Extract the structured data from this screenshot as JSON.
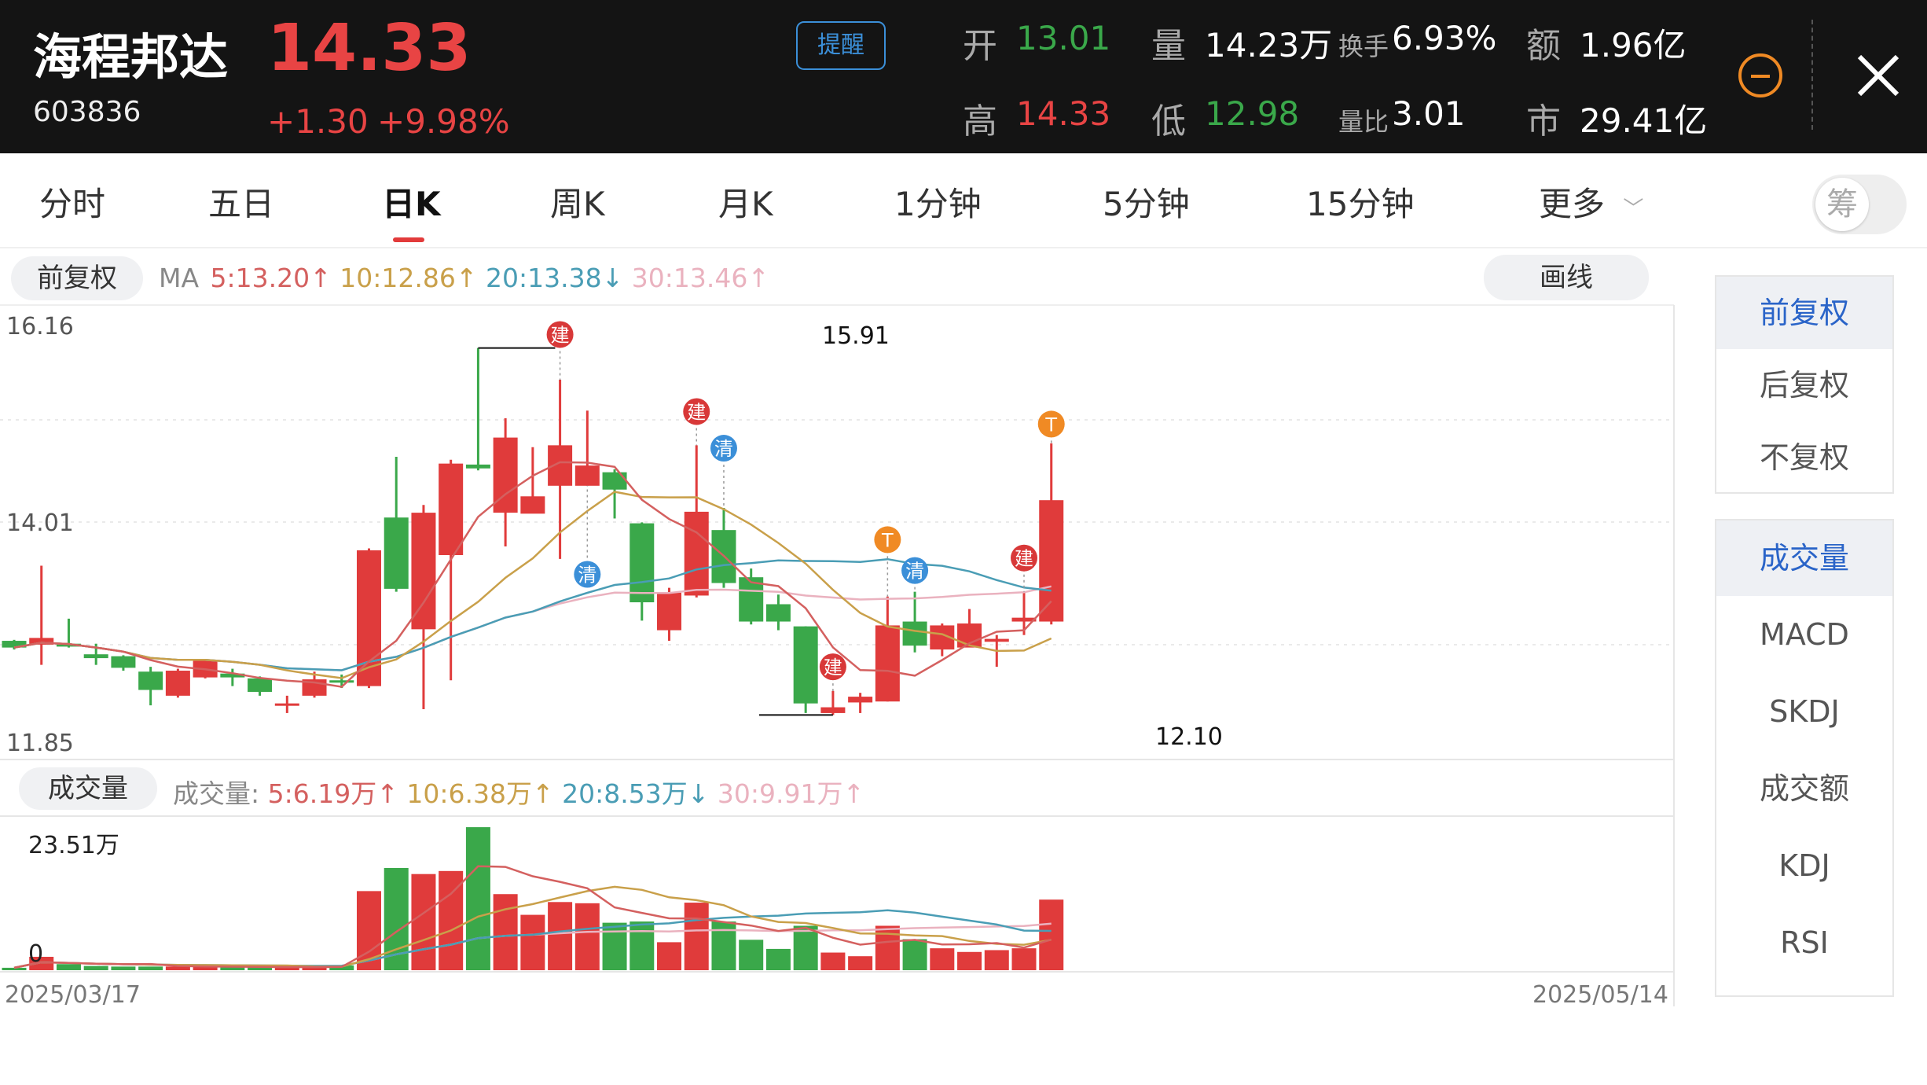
{
  "stock": {
    "name": "海程邦达",
    "code": "603836",
    "price": "14.33",
    "change": "+1.30",
    "change_pct": "+9.98%",
    "alert_label": "提醒"
  },
  "quote": {
    "open_label": "开",
    "open": "13.01",
    "volume_label": "量",
    "volume": "14.23万",
    "turnover_label": "换手",
    "turnover": "6.93%",
    "amount_label": "额",
    "amount": "1.96亿",
    "high_label": "高",
    "high": "14.33",
    "low_label": "低",
    "low": "12.98",
    "vol_ratio_label": "量比",
    "vol_ratio": "3.01",
    "mcap_label": "市",
    "mcap": "29.41亿"
  },
  "tabs": {
    "items": [
      "分时",
      "五日",
      "日K",
      "周K",
      "月K",
      "1分钟",
      "5分钟",
      "15分钟",
      "更多"
    ],
    "active": "日K",
    "chip_toggle": "筹"
  },
  "toolbar": {
    "adjust": "前复权",
    "draw": "画线",
    "ma_label": "MA",
    "ma5": "5:13.20",
    "ma10": "10:12.86",
    "ma20": "20:13.38",
    "ma30": "30:13.46"
  },
  "volume_bar": {
    "label": "成交量",
    "prefix": "成交量:",
    "ma5": "5:6.19万",
    "ma10": "10:6.38万",
    "ma20": "20:8.53万",
    "ma30": "30:9.91万"
  },
  "side_panel": {
    "adjust_items": [
      "前复权",
      "后复权",
      "不复权"
    ],
    "indicator_items": [
      "成交量",
      "MACD",
      "SKDJ",
      "成交额",
      "KDJ",
      "RSI"
    ]
  },
  "colors": {
    "up": "#e03b3b",
    "down": "#3aa84a",
    "ma5": "#d4605f",
    "ma10": "#c9a04a",
    "ma20": "#4a9db5",
    "ma30": "#eab2bf",
    "accent_orange": "#f08a24",
    "accent_blue": "#3b8fd8"
  },
  "chart_data": {
    "type": "candlestick",
    "price_axis": {
      "top_label": "16.16",
      "mid_label": "14.01",
      "bottom_label": "11.85",
      "ylim": [
        11.85,
        16.16
      ]
    },
    "volume_axis": {
      "top_label": "23.51万",
      "bottom_label": "0",
      "ylim": [
        0,
        23.51
      ]
    },
    "start_date": "2025/03/17",
    "end_date": "2025/05/14",
    "high_annotation": "15.91",
    "low_annotation": "12.10",
    "candles": [
      {
        "o": 12.87,
        "c": 12.8,
        "h": 12.88,
        "l": 12.78,
        "v": 0.4
      },
      {
        "o": 12.83,
        "c": 12.9,
        "h": 13.65,
        "l": 12.62,
        "v": 2.2
      },
      {
        "o": 12.84,
        "c": 12.81,
        "h": 13.1,
        "l": 12.8,
        "v": 1.0
      },
      {
        "o": 12.73,
        "c": 12.69,
        "h": 12.84,
        "l": 12.62,
        "v": 0.7
      },
      {
        "o": 12.71,
        "c": 12.59,
        "h": 12.72,
        "l": 12.56,
        "v": 0.6
      },
      {
        "o": 12.55,
        "c": 12.36,
        "h": 12.6,
        "l": 12.2,
        "v": 0.6
      },
      {
        "o": 12.3,
        "c": 12.56,
        "h": 12.58,
        "l": 12.28,
        "v": 0.6
      },
      {
        "o": 12.49,
        "c": 12.67,
        "h": 12.68,
        "l": 12.48,
        "v": 0.6
      },
      {
        "o": 12.53,
        "c": 12.49,
        "h": 12.58,
        "l": 12.4,
        "v": 0.5
      },
      {
        "o": 12.48,
        "c": 12.34,
        "h": 12.5,
        "l": 12.3,
        "v": 0.5
      },
      {
        "o": 12.2,
        "c": 12.22,
        "h": 12.3,
        "l": 12.12,
        "v": 0.4
      },
      {
        "o": 12.3,
        "c": 12.47,
        "h": 12.55,
        "l": 12.28,
        "v": 0.5
      },
      {
        "o": 12.46,
        "c": 12.44,
        "h": 12.52,
        "l": 12.38,
        "v": 0.8
      },
      {
        "o": 12.4,
        "c": 13.81,
        "h": 13.83,
        "l": 12.38,
        "v": 13.0
      },
      {
        "o": 14.15,
        "c": 13.41,
        "h": 14.78,
        "l": 13.38,
        "v": 16.8
      },
      {
        "o": 12.99,
        "c": 14.2,
        "h": 14.28,
        "l": 12.16,
        "v": 15.8
      },
      {
        "o": 13.76,
        "c": 14.71,
        "h": 14.75,
        "l": 12.46,
        "v": 16.3
      },
      {
        "o": 14.7,
        "c": 14.66,
        "h": 15.91,
        "l": 14.64,
        "v": 23.5
      },
      {
        "o": 14.2,
        "c": 14.98,
        "h": 15.18,
        "l": 13.85,
        "v": 12.5
      },
      {
        "o": 14.19,
        "c": 14.37,
        "h": 14.88,
        "l": 14.2,
        "v": 9.1
      },
      {
        "o": 14.48,
        "c": 14.9,
        "h": 15.58,
        "l": 13.72,
        "v": 11.2
      },
      {
        "o": 14.48,
        "c": 14.69,
        "h": 15.26,
        "l": 14.48,
        "v": 11.0
      },
      {
        "o": 14.62,
        "c": 14.44,
        "h": 14.65,
        "l": 14.14,
        "v": 7.8
      },
      {
        "o": 14.09,
        "c": 13.27,
        "h": 14.1,
        "l": 13.08,
        "v": 8.0
      },
      {
        "o": 12.98,
        "c": 13.37,
        "h": 13.42,
        "l": 12.87,
        "v": 4.6
      },
      {
        "o": 13.34,
        "c": 14.21,
        "h": 14.9,
        "l": 13.32,
        "v": 11.1
      },
      {
        "o": 14.02,
        "c": 13.47,
        "h": 14.25,
        "l": 13.42,
        "v": 8.0
      },
      {
        "o": 13.53,
        "c": 13.07,
        "h": 13.62,
        "l": 13.04,
        "v": 5.0
      },
      {
        "o": 13.25,
        "c": 13.07,
        "h": 13.35,
        "l": 12.98,
        "v": 3.5
      },
      {
        "o": 13.02,
        "c": 12.22,
        "h": 13.02,
        "l": 12.12,
        "v": 7.3
      },
      {
        "o": 12.12,
        "c": 12.18,
        "h": 12.35,
        "l": 12.1,
        "v": 2.9
      },
      {
        "o": 12.23,
        "c": 12.29,
        "h": 12.33,
        "l": 12.12,
        "v": 2.3
      },
      {
        "o": 12.24,
        "c": 13.03,
        "h": 13.33,
        "l": 12.24,
        "v": 7.3
      },
      {
        "o": 13.07,
        "c": 12.82,
        "h": 13.38,
        "l": 12.75,
        "v": 5.1
      },
      {
        "o": 12.78,
        "c": 13.03,
        "h": 13.05,
        "l": 12.71,
        "v": 3.6
      },
      {
        "o": 12.8,
        "c": 13.05,
        "h": 13.2,
        "l": 12.81,
        "v": 3.0
      },
      {
        "o": 12.86,
        "c": 12.89,
        "h": 12.93,
        "l": 12.6,
        "v": 3.3
      },
      {
        "o": 13.07,
        "c": 13.11,
        "h": 13.38,
        "l": 12.93,
        "v": 3.6
      },
      {
        "o": 13.07,
        "c": 14.33,
        "h": 14.92,
        "l": 13.04,
        "v": 11.6
      }
    ],
    "markers": [
      {
        "i": 20,
        "text": "建",
        "color": "#d83838",
        "price": 16.05
      },
      {
        "i": 21,
        "text": "清",
        "color": "#3b8fd8",
        "price": 13.56
      },
      {
        "i": 25,
        "text": "建",
        "color": "#d83838",
        "price": 15.25
      },
      {
        "i": 26,
        "text": "清",
        "color": "#3b8fd8",
        "price": 14.87
      },
      {
        "i": 30,
        "text": "建",
        "color": "#d83838",
        "price": 12.6
      },
      {
        "i": 32,
        "text": "T",
        "color": "#f08a24",
        "price": 13.92
      },
      {
        "i": 33,
        "text": "清",
        "color": "#3b8fd8",
        "price": 13.6
      },
      {
        "i": 37,
        "text": "建",
        "color": "#d83838",
        "price": 13.73
      },
      {
        "i": 38,
        "text": "T",
        "color": "#f08a24",
        "price": 15.12
      }
    ]
  }
}
